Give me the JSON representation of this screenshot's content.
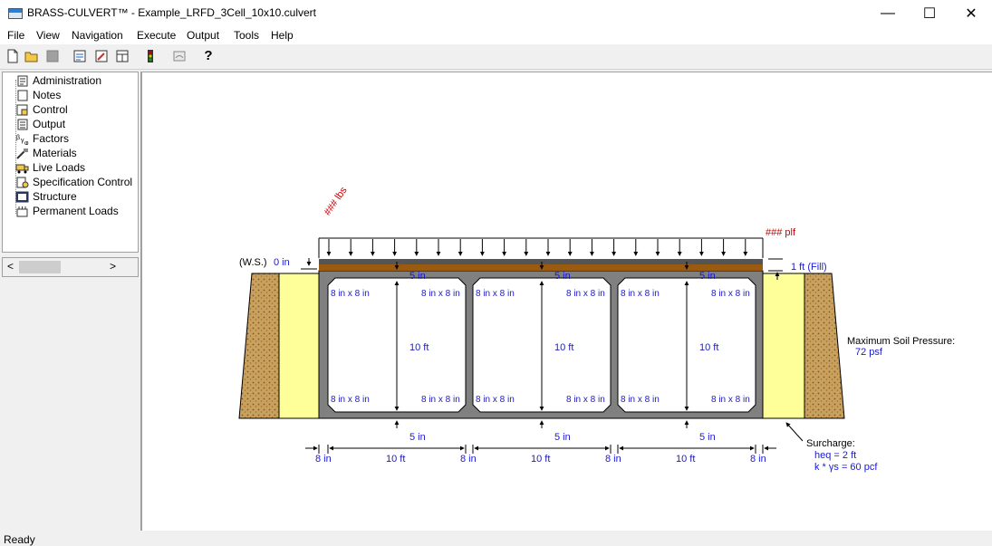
{
  "window": {
    "title": "BRASS-CULVERT™ - Example_LRFD_3Cell_10x10.culvert",
    "minimize": "—",
    "maximize": "☐",
    "close": "✕"
  },
  "menu": [
    "File",
    "View",
    "Navigation",
    "Execute",
    "Output",
    "Tools",
    "Help"
  ],
  "toolbar": {
    "help_glyph": "?"
  },
  "tree": [
    "Administration",
    "Notes",
    "Control",
    "Output",
    "Factors",
    "Materials",
    "Live Loads",
    "Specification Control",
    "Structure",
    "Permanent Loads"
  ],
  "scroll": {
    "left": "<",
    "right": ">"
  },
  "drawing": {
    "point_load": "### lbs",
    "line_load": "### plf",
    "ws_label": "(W.S.)",
    "ws_value": "0  in",
    "fill_label": "1  ft  (Fill)",
    "top_slab": "5  in",
    "haunch": "8  in x 8  in",
    "cell_height": "10  ft",
    "bottom_slab": "5  in",
    "wall": "8  in",
    "cell_width": "10  ft",
    "soil_pressure_label": "Maximum Soil Pressure:",
    "soil_pressure_value": "72 psf",
    "surcharge_label": "Surcharge:",
    "heq": "heq = 2  ft",
    "kys": "k * γs = 60 pcf"
  },
  "colors": {
    "dimension": "#1a1acc",
    "load": "#cc0000",
    "wall": "#808080",
    "soil": "#c8a060",
    "fill": "#ffff99",
    "pavement": "#9a5a10"
  },
  "status": "Ready"
}
